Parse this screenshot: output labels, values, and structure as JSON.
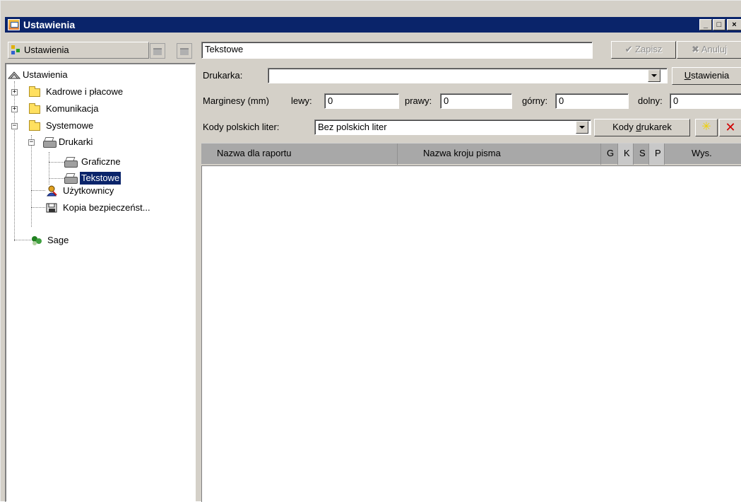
{
  "window": {
    "title": "Ustawienia",
    "controls": {
      "minimize": "_",
      "maximize": "□",
      "close": "×"
    }
  },
  "left_panel": {
    "header_label": "Ustawienia",
    "tree": {
      "root": "Ustawienia",
      "kadrowe": "Kadrowe i płacowe",
      "komunikacja": "Komunikacja",
      "systemowe": "Systemowe",
      "drukarki": "Drukarki",
      "graficzne": "Graficzne",
      "tekstowe": "Tekstowe",
      "uzytkownicy": "Użytkownicy",
      "kopia": "Kopia bezpieczeńst...",
      "sage": "Sage"
    }
  },
  "right_panel": {
    "name_field": "Tekstowe",
    "save_button": "Zapisz",
    "cancel_button": "Anuluj",
    "printer_label": "Drukarka:",
    "printer_value": "",
    "settings_button_prefix": "",
    "settings_button_underlined": "U",
    "settings_button_rest": "stawienia",
    "margins_label": "Marginesy (mm)",
    "left_label": "lewy:",
    "left_value": "0",
    "right_label": "prawy:",
    "right_value": "0",
    "top_label": "górny:",
    "top_value": "0",
    "bottom_label": "dolny:",
    "bottom_value": "0",
    "polish_codes_label": "Kody polskich liter:",
    "polish_codes_value": "Bez polskich liter",
    "printer_codes_prefix": "Kody ",
    "printer_codes_underlined": "d",
    "printer_codes_rest": "rukarek",
    "grid_columns": [
      "Nazwa dla raportu",
      "Nazwa kroju pisma",
      "G",
      "K",
      "S",
      "P",
      "Wys."
    ]
  },
  "colors": {
    "titlebar": "#0a246a",
    "face": "#d4d0c8",
    "header_dark": "#a8a8a8",
    "header_light": "#c8c8c8",
    "selection": "#0a246a",
    "folder": "#ffe060"
  },
  "icons": {
    "title": "app-settings-icon",
    "tree_root": "settings-tree-icon",
    "save": "check-icon",
    "cancel": "x-icon",
    "new": "sparkle-new-icon",
    "delete": "red-x-delete-icon"
  }
}
